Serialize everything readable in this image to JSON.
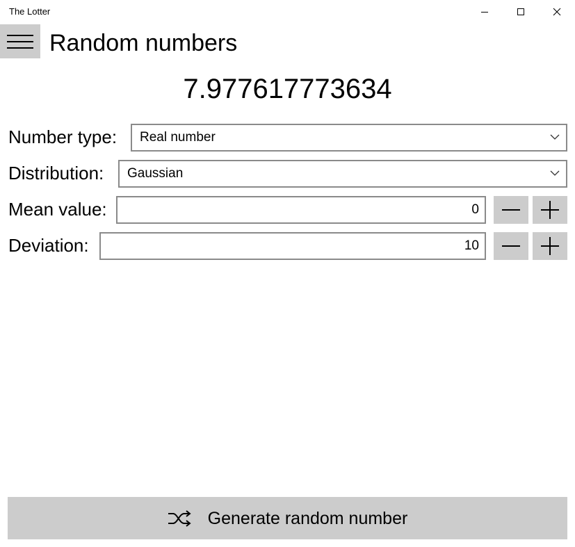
{
  "window": {
    "title": "The Lotter",
    "controls": [
      "minimize-icon",
      "maximize-icon",
      "close-icon"
    ]
  },
  "header": {
    "menu_icon": "hamburger-menu-icon",
    "title": "Random numbers"
  },
  "result": {
    "value": "7.977617773634"
  },
  "form": {
    "number_type": {
      "label": "Number type:",
      "selected": "Real number"
    },
    "distribution": {
      "label": "Distribution:",
      "selected": "Gaussian"
    },
    "mean": {
      "label": "Mean value:",
      "value": "0",
      "decrement_icon": "minus-icon",
      "increment_icon": "plus-icon"
    },
    "deviation": {
      "label": "Deviation:",
      "value": "10",
      "decrement_icon": "minus-icon",
      "increment_icon": "plus-icon"
    }
  },
  "generate": {
    "icon": "shuffle-icon",
    "label": "Generate random number"
  },
  "colors": {
    "button_background": "#cccccc",
    "field_border": "#8a8a8a",
    "window_background": "#ffffff",
    "text": "#000000"
  }
}
